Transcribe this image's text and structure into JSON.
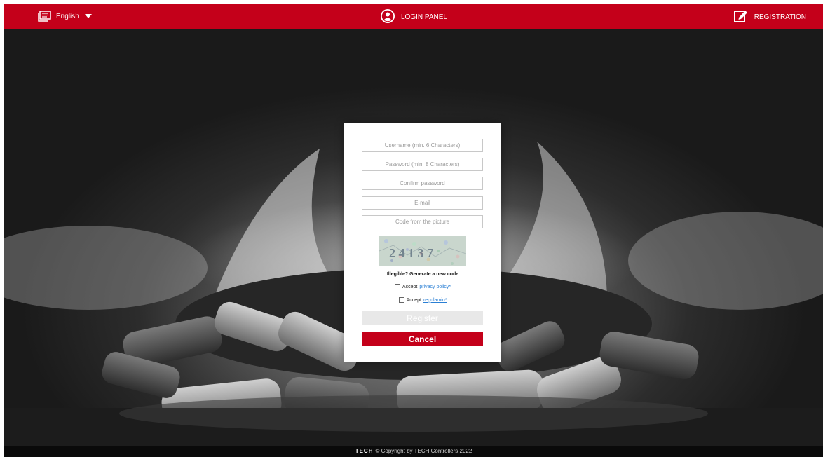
{
  "header": {
    "language": "English",
    "login_label": "LOGIN PANEL",
    "registration_label": "REGISTRATION"
  },
  "form": {
    "username_placeholder": "Username (min. 6 Characters)",
    "password_placeholder": "Password (min. 8 Characters)",
    "confirm_placeholder": "Confirm password",
    "email_placeholder": "E-mail",
    "code_placeholder": "Code from the picture",
    "captcha_text": "2 4 1 3 7",
    "regenerate_label": "Illegible? Generate a new code",
    "privacy_prefix": "Accept",
    "privacy_link": "privacy policy*",
    "regulamin_prefix": "Accept",
    "regulamin_link": "regulamin*",
    "register_label": "Register",
    "cancel_label": "Cancel"
  },
  "footer": {
    "brand": "TECH",
    "copyright": "© Copyright by TECH Controllers 2022"
  },
  "colors": {
    "brand_red": "#c4001a",
    "link_blue": "#2a7fd4",
    "disabled_gray": "#e8e8e8"
  },
  "icons": {
    "language": "language-icon",
    "user": "user-circle-icon",
    "edit": "edit-square-icon"
  }
}
